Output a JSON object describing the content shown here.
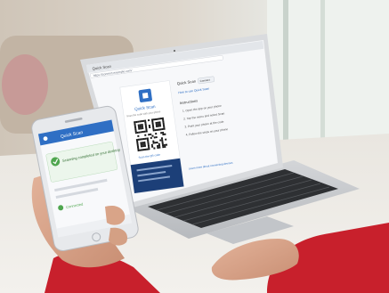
{
  "laptop_screen": {
    "tab_title": "Quick Scan",
    "address_bar": "https://connect.example.com/",
    "qr_card": {
      "title": "Quick Scan",
      "subtitle": "Scan the code with your phone",
      "link": "Scan the QR code"
    },
    "instructions": {
      "heading": "Quick Scan",
      "button": "Connect",
      "link": "How to use Quick Scan",
      "title": "Instructions",
      "steps": [
        "1. Open the app on your phone",
        "2. Tap the menu and select Scan",
        "3. Point your phone at the code",
        "4. Follow the steps on your phone"
      ],
      "footer": "Learn more about connecting devices"
    }
  },
  "phone_screen": {
    "header": "Quick Scan",
    "message": "Scanning completed on your desktop",
    "status": "Connected"
  },
  "colors": {
    "accent_blue": "#2f6fc4",
    "dark_navy": "#1c3f78",
    "sleeve_red": "#c8202c",
    "success_green": "#4fa64f"
  }
}
